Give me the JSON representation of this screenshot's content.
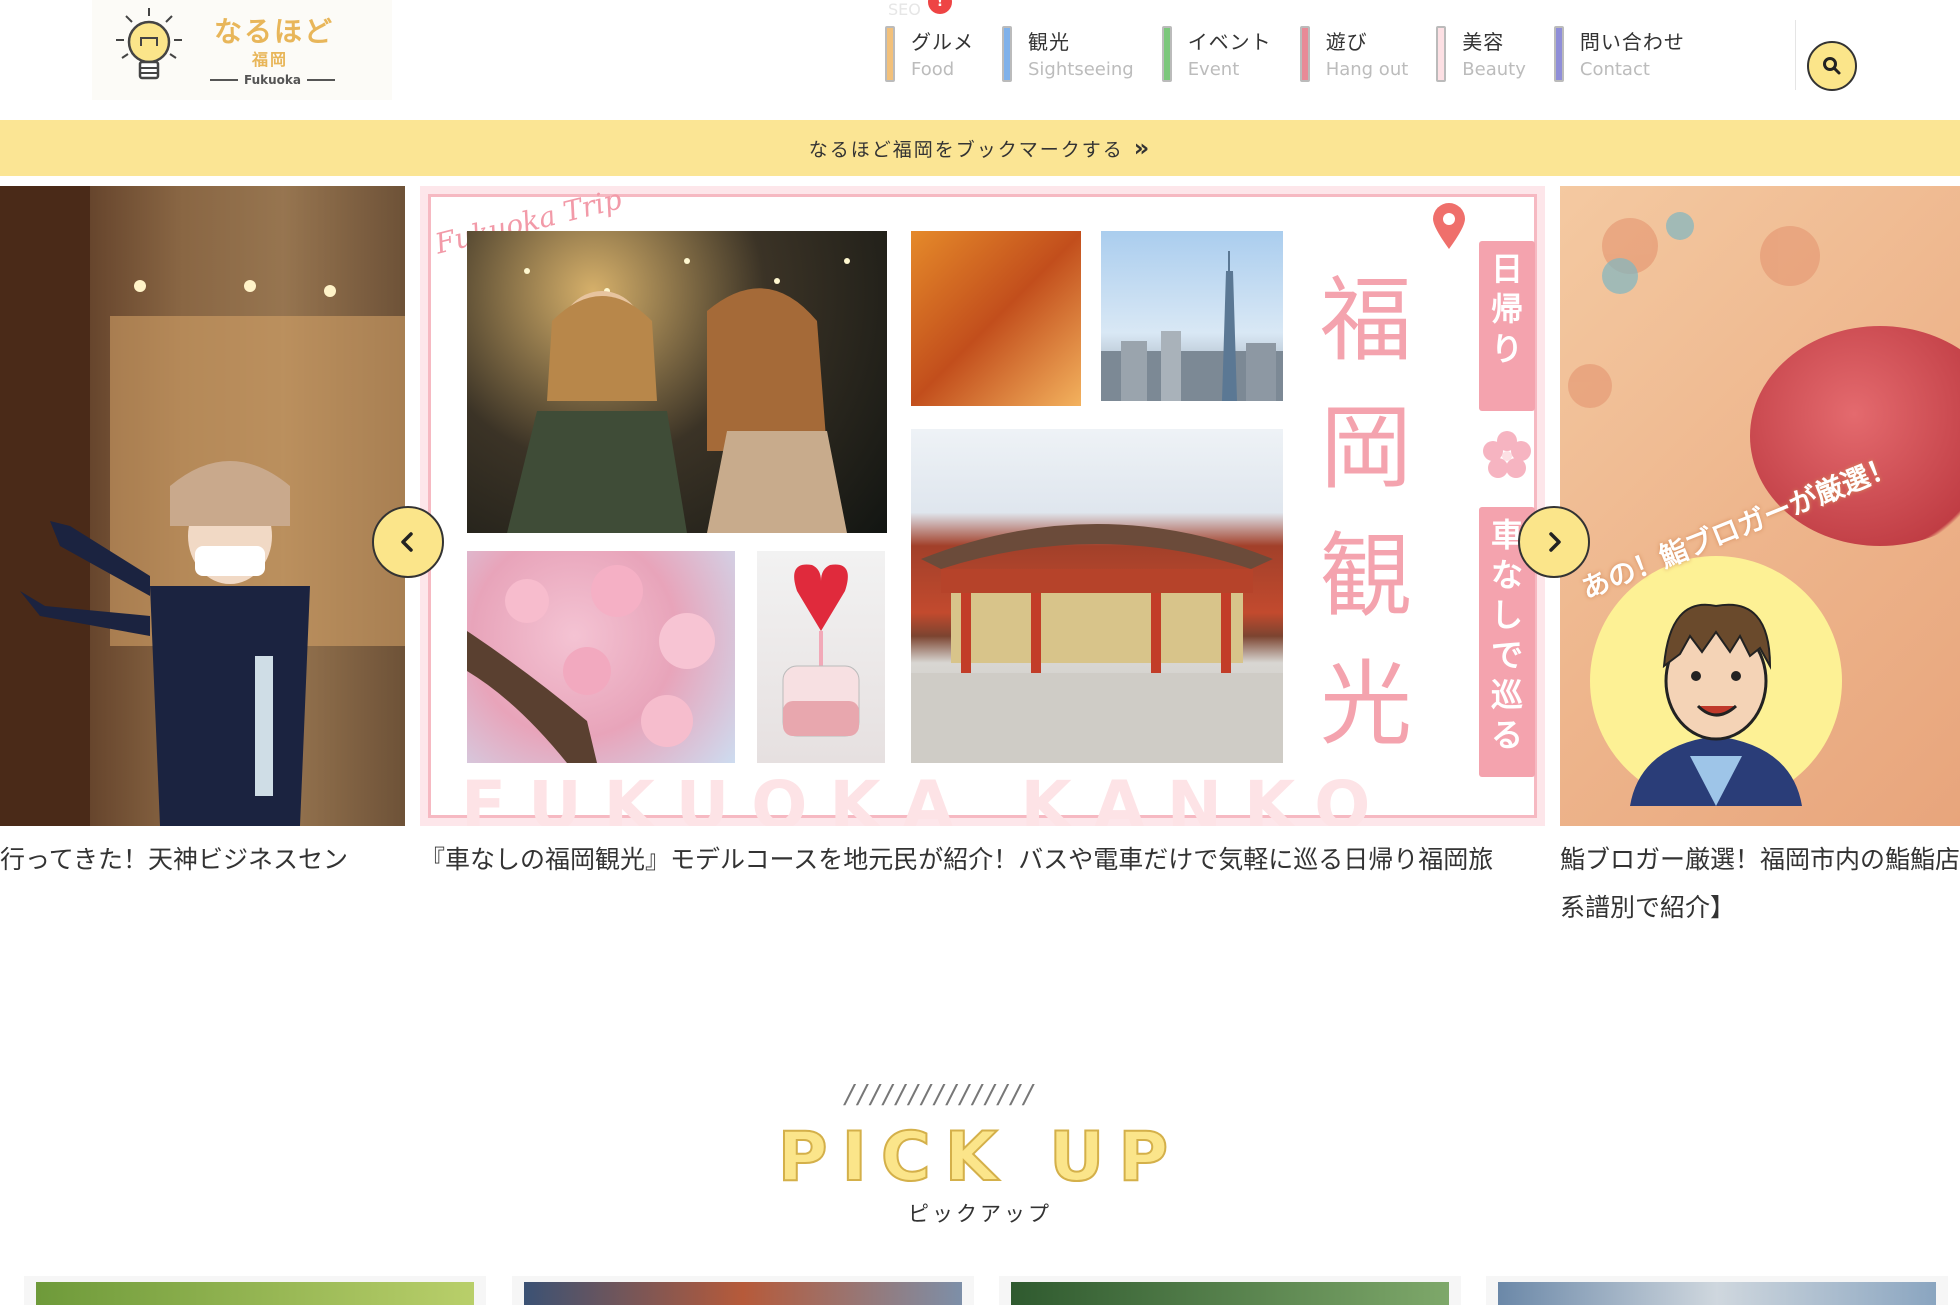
{
  "logo": {
    "title": "なるほど",
    "subtitle": "福岡",
    "english": "Fukuoka"
  },
  "seo_label": "SEO",
  "seo_badge": "!",
  "nav": [
    {
      "jp": "グルメ",
      "en": "Food",
      "color": "#f2c07a"
    },
    {
      "jp": "観光",
      "en": "Sightseeing",
      "color": "#7fb1ea"
    },
    {
      "jp": "イベント",
      "en": "Event",
      "color": "#7cc77c"
    },
    {
      "jp": "遊び",
      "en": "Hang out",
      "color": "#e88a97"
    },
    {
      "jp": "美容",
      "en": "Beauty",
      "color": "#fde0e4"
    },
    {
      "jp": "問い合わせ",
      "en": "Contact",
      "color": "#8f8ed8"
    }
  ],
  "bookmark": {
    "label": "なるほど福岡をブックマークする",
    "chevron": "»"
  },
  "slider": {
    "left_caption": "行ってきた！天神ビジネスセン",
    "center_caption": "『車なしの福岡観光』モデルコースを地元民が紹介！バスや電車だけで気軽に巡る日帰り福岡旅",
    "right_caption": "鮨ブロガー厳選！福岡市内の鮨鮨店系譜別で紹介】",
    "center_banner": {
      "script": "Fukuoka Trip",
      "title": "福岡観光",
      "tag_top": "日帰り",
      "tag_bottom": "車なしで巡る",
      "watermark": "FUKUOKA KANKO"
    },
    "right_banner": {
      "badge_text": "あの！鮨ブロガーが厳選！"
    }
  },
  "pickup": {
    "slashes": "///////////////",
    "title": "PICK UP",
    "subtitle": "ピックアップ"
  },
  "icons": {
    "search": "search-icon",
    "prev": "chevron-left-icon",
    "next": "chevron-right-icon",
    "bulb": "lightbulb-icon"
  },
  "colors": {
    "accent_yellow": "#fbe58a",
    "bookmark_bg": "#fbe594",
    "logo_orange": "#e8b65a",
    "pink": "#f4a3ae"
  }
}
